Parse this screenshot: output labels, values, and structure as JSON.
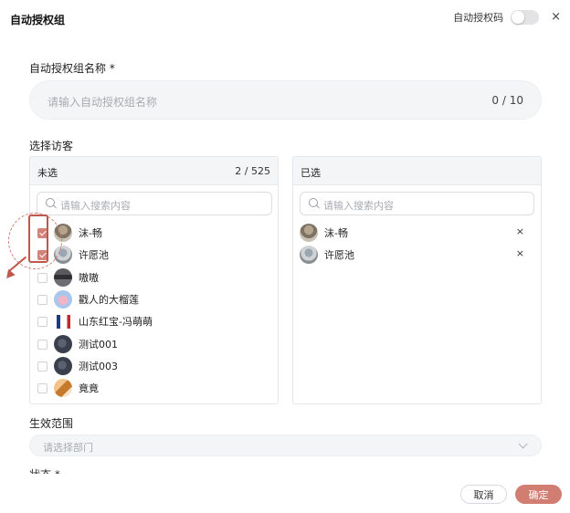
{
  "header": {
    "title": "自动授权组",
    "auth_code_label": "自动授权码",
    "auth_code_enabled": false,
    "close": "×"
  },
  "name_field": {
    "label": "自动授权组名称 *",
    "placeholder": "请输入自动授权组名称",
    "counter": "0 / 10"
  },
  "visitors": {
    "label": "选择访客",
    "unselected": {
      "title": "未选",
      "count": "2 / 525",
      "search_placeholder": "请输入搜索内容",
      "items": [
        {
          "name": "沫-畅",
          "checked": true,
          "avatar": "photo-avatar"
        },
        {
          "name": "许愿池",
          "checked": true,
          "avatar": "photo-avatar"
        },
        {
          "name": "嗷嗷",
          "checked": false,
          "avatar": "dark-avatar"
        },
        {
          "name": "戳人的大榴莲",
          "checked": false,
          "avatar": "cartoon-avatar"
        },
        {
          "name": "山东红宝-冯萌萌",
          "checked": false,
          "avatar": "logo-avatar"
        },
        {
          "name": "测试001",
          "checked": false,
          "avatar": "dark-avatar"
        },
        {
          "name": "测试003",
          "checked": false,
          "avatar": "dark-avatar"
        },
        {
          "name": "竟竟",
          "checked": false,
          "avatar": "orange-avatar"
        }
      ]
    },
    "selected": {
      "title": "已选",
      "search_placeholder": "请输入搜索内容",
      "items": [
        {
          "name": "沫-畅",
          "remove": "×",
          "avatar": "photo-avatar"
        },
        {
          "name": "许愿池",
          "remove": "×",
          "avatar": "photo-avatar"
        }
      ]
    }
  },
  "scope": {
    "label": "生效范围",
    "placeholder": "请选择部门"
  },
  "clipped_label": "状态 *",
  "footer": {
    "cancel": "取消",
    "confirm": "确定"
  },
  "colors": {
    "accent": "#d17d72",
    "annotation": "#c0574c"
  }
}
